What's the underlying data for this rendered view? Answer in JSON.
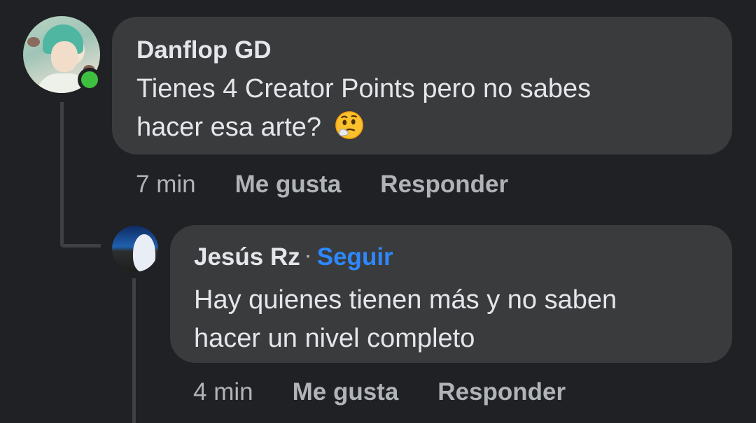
{
  "comments": [
    {
      "author": "Danflop GD",
      "text_line1": "Tienes 4 Creator Points pero no sabes",
      "text_line2": "hacer esa arte?",
      "emoji": "thinking-face-icon",
      "time": "7 min",
      "like": "Me gusta",
      "reply": "Responder",
      "online": true
    },
    {
      "author": "Jesús Rz",
      "separator": "·",
      "follow": "Seguir",
      "text_line1": "Hay quienes tienen más y no saben",
      "text_line2": "hacer un nivel completo",
      "time": "4 min",
      "like": "Me gusta",
      "reply": "Responder"
    }
  ],
  "colors": {
    "background": "#202124",
    "bubble": "#3a3b3c",
    "text": "#e4e6eb",
    "muted": "#b0b3b8",
    "link": "#2d88ff",
    "online": "#3fbf3f"
  }
}
